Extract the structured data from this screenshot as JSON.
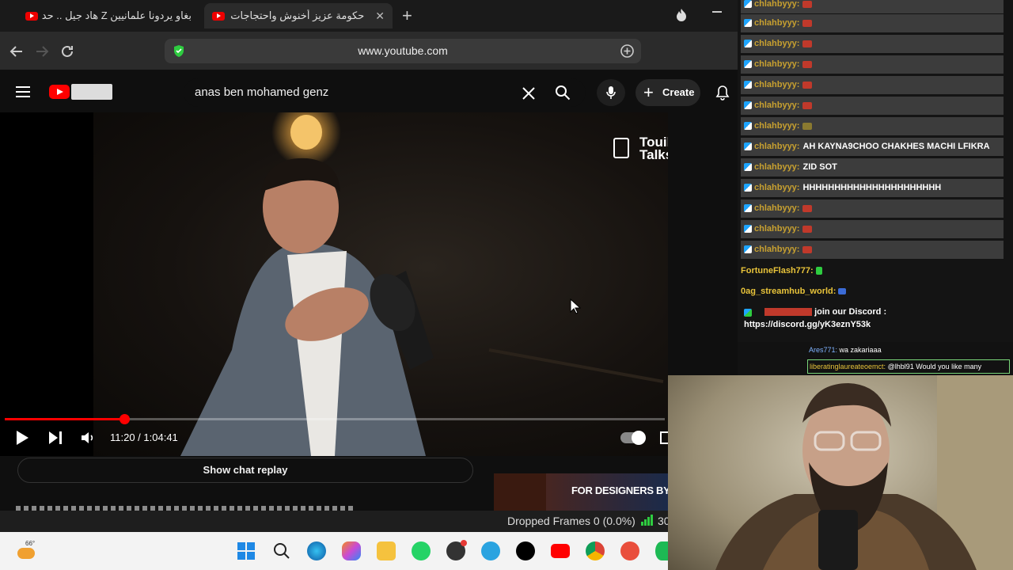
{
  "tabs": [
    {
      "title": "بغاو يردونا علمانيين Z هاد جيل .. حدة",
      "active": false
    },
    {
      "title": "حكومة عزيز أخنوش واحتجاجات",
      "active": true
    }
  ],
  "address_bar": {
    "url": "www.youtube.com"
  },
  "youtube": {
    "search_value": "anas ben mohamed genz",
    "create_label": "Create",
    "watermark_line1": "Touil",
    "watermark_line2": "Talks",
    "progress_fraction": 0.1814,
    "time_display": "11:20 / 1:04:41",
    "show_chat_replay": "Show chat replay",
    "ad_text": "FOR DESIGNERS BY DES"
  },
  "obs_status": {
    "dropped_frames": "Dropped Frames 0 (0.0%)",
    "fps": "30"
  },
  "chat": {
    "rows": [
      {
        "user": "chlahbyyy:",
        "msg": "",
        "emote": true
      },
      {
        "user": "chlahbyyy:",
        "msg": "",
        "emote": true
      },
      {
        "user": "chlahbyyy:",
        "msg": "",
        "emote": true
      },
      {
        "user": "chlahbyyy:",
        "msg": "",
        "emote": true
      },
      {
        "user": "chlahbyyy:",
        "msg": "",
        "emote": true
      },
      {
        "user": "chlahbyyy:",
        "msg": "",
        "emote": true
      },
      {
        "user": "chlahbyyy:",
        "msg": "",
        "emote": true
      },
      {
        "user": "chlahbyyy:",
        "msg": "AH KAYNA9CHOO CHAKHES MACHI LFIKRA",
        "emote": false
      },
      {
        "user": "chlahbyyy:",
        "msg": "ZID SOT",
        "emote": false
      },
      {
        "user": "chlahbyyy:",
        "msg": "HHHHHHHHHHHHHHHHHHHHHH",
        "emote": false
      },
      {
        "user": "chlahbyyy:",
        "msg": "",
        "emote": true
      },
      {
        "user": "chlahbyyy:",
        "msg": "",
        "emote": true
      },
      {
        "user": "chlahbyyy:",
        "msg": "",
        "emote": true
      }
    ],
    "fortune_user": "FortuneFlash777:",
    "streamhub_user": "0ag_streamhub_world:",
    "discord_line1": "join our Discord :",
    "discord_line2": "https://discord.gg/yK3eznY53k",
    "secondary": [
      {
        "user": "Ares771:",
        "msg": "wa zakariaaa"
      },
      {
        "user": "liberatinglaureateoemct:",
        "msg": "@lhbl91 Would you like many"
      }
    ]
  },
  "taskbar": {
    "weather_temp": "66°"
  },
  "colors": {
    "youtube_red": "#ff0000",
    "chat_row_bg": "#3c3c3c",
    "chat_user": "#c7a030",
    "taskbar_bg": "#f3f3f3"
  }
}
